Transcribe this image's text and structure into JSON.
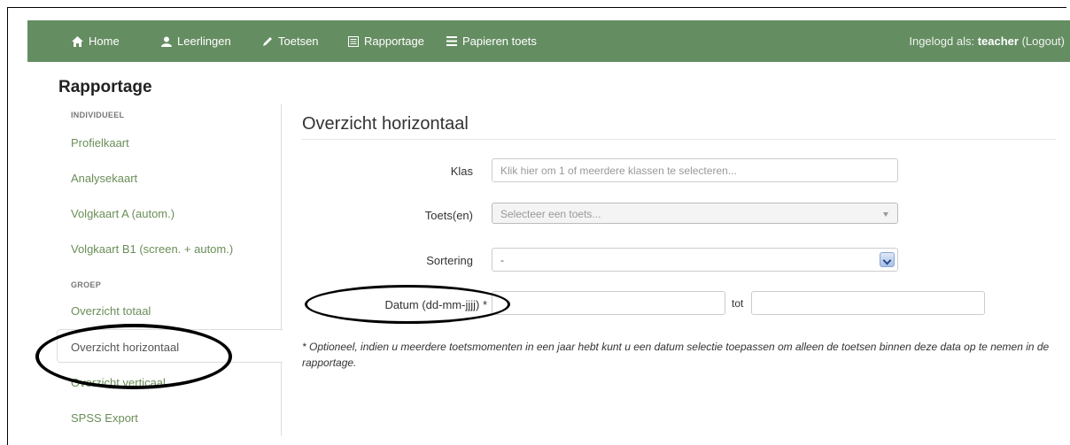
{
  "navbar": {
    "items": [
      {
        "label": "Home",
        "icon": "home-icon"
      },
      {
        "label": "Leerlingen",
        "icon": "user-icon"
      },
      {
        "label": "Toetsen",
        "icon": "pencil-icon"
      },
      {
        "label": "Rapportage",
        "icon": "report-icon"
      },
      {
        "label": "Papieren toets",
        "icon": "list-icon"
      }
    ],
    "login_prefix": "Ingelogd als: ",
    "login_user": "teacher",
    "logout_label": "(Logout)"
  },
  "page_title": "Rapportage",
  "sidebar": {
    "section_individueel": "INDIVIDUEEL",
    "section_groep": "GROEP",
    "items": [
      {
        "label": "Profielkaart"
      },
      {
        "label": "Analysekaart"
      },
      {
        "label": "Volgkaart A (autom.)"
      },
      {
        "label": "Volgkaart B1 (screen. + autom.)"
      },
      {
        "label": "Overzicht totaal"
      },
      {
        "label": "Overzicht horizontaal",
        "active": true
      },
      {
        "label": "Overzicht verticaal"
      },
      {
        "label": "SPSS Export"
      }
    ]
  },
  "content": {
    "title": "Overzicht horizontaal",
    "form": {
      "klas_label": "Klas",
      "klas_placeholder": "Klik hier om 1 of meerdere klassen te selecteren...",
      "toetsen_label": "Toets(en)",
      "toetsen_placeholder": "Selecteer een toets...",
      "sortering_label": "Sortering",
      "sortering_value": "-",
      "datum_label": "Datum (dd-mm-jjjj) *",
      "datum_from_value": "",
      "tot_label": "tot",
      "datum_to_value": ""
    },
    "note": "* Optioneel, indien u meerdere toetsmomenten in een jaar hebt kunt u een datum selectie toepassen om alleen de toetsen binnen deze data op te nemen in de rapportage."
  },
  "colors": {
    "navbar": "#658d62",
    "link": "#6b8e58"
  }
}
